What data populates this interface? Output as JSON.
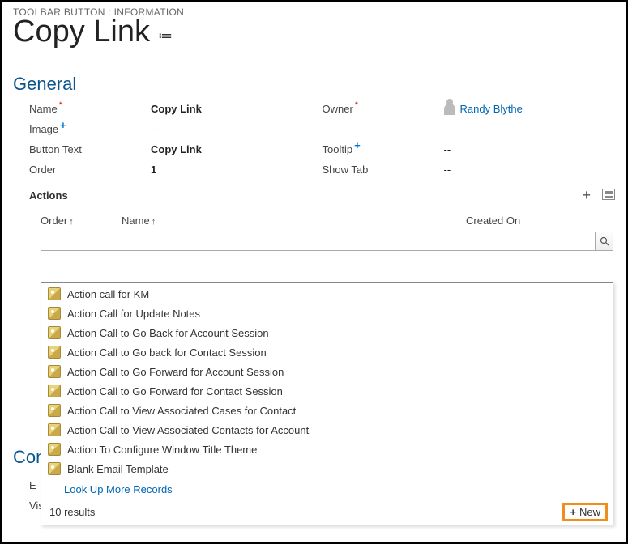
{
  "header": {
    "breadcrumb": "TOOLBAR BUTTON : INFORMATION",
    "title": "Copy Link"
  },
  "section_general_title": "General",
  "fields": {
    "name_label": "Name",
    "name_value": "Copy Link",
    "owner_label": "Owner",
    "owner_value": "Randy Blythe",
    "image_label": "Image",
    "image_value": "--",
    "button_text_label": "Button Text",
    "button_text_value": "Copy Link",
    "tooltip_label": "Tooltip",
    "tooltip_value": "--",
    "order_label": "Order",
    "order_value": "1",
    "showtab_label": "Show Tab",
    "showtab_value": "--"
  },
  "actions": {
    "title": "Actions",
    "columns": {
      "order": "Order",
      "name": "Name",
      "created": "Created On"
    }
  },
  "lookup": {
    "placeholder": "",
    "items": [
      "Action call for KM",
      "Action Call for Update Notes",
      "Action Call to Go Back for Account Session",
      "Action Call to Go back for Contact Session",
      "Action Call to Go Forward for Account Session",
      "Action Call to Go Forward for Contact Session",
      "Action Call to View Associated Cases for Contact",
      "Action Call to View Associated Contacts for Account",
      "Action To Configure Window Title Theme",
      "Blank Email Template"
    ],
    "more_label": "Look Up More Records",
    "results_text": "10 results",
    "new_label": "New"
  },
  "bottom": {
    "section_title": "Con",
    "enable_label_part": "E",
    "visible_label": "Visible Condition",
    "visible_value": "--"
  }
}
